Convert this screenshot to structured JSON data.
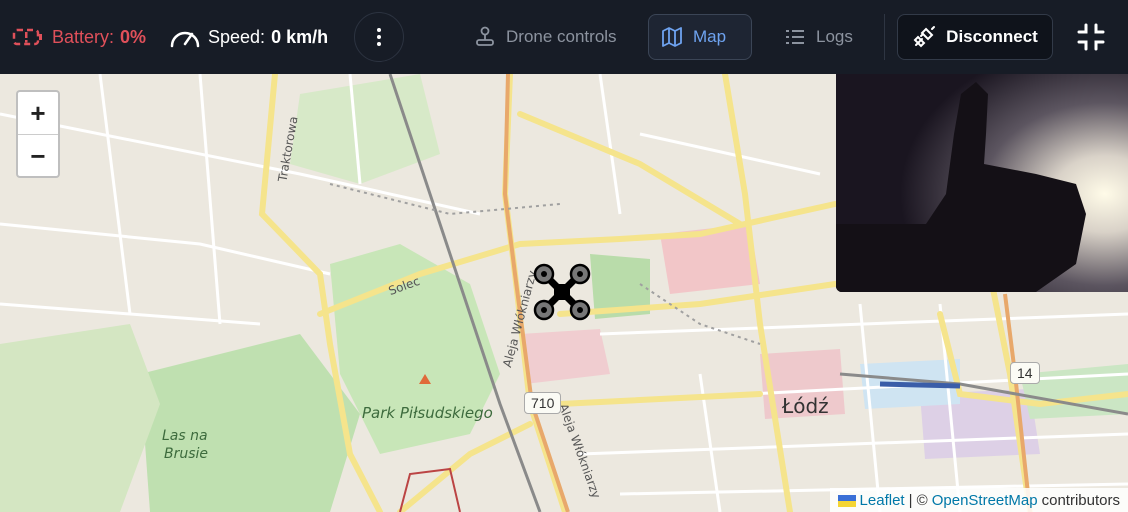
{
  "topbar": {
    "battery": {
      "label": "Battery:",
      "value": "0%",
      "color": "#e0505a",
      "icon": "battery-alert-icon"
    },
    "speed": {
      "label": "Speed:",
      "value": "0 km/h",
      "icon": "speedometer-icon"
    },
    "more_icon": "more-vertical-icon",
    "nav": [
      {
        "label": "Drone controls",
        "icon": "joystick-icon",
        "active": false
      },
      {
        "label": "Map",
        "icon": "map-icon",
        "active": true
      },
      {
        "label": "Logs",
        "icon": "list-icon",
        "active": false
      }
    ],
    "disconnect_label": "Disconnect",
    "disconnect_icon": "unplug-icon",
    "fullscreen_icon": "exit-fullscreen-icon",
    "accent": "#6ea3f0"
  },
  "map": {
    "zoom_in": "+",
    "zoom_out": "−",
    "labels": {
      "traktorowa": "Traktorowa",
      "solec": "Solec",
      "aleja": "Aleja Włókniarzy",
      "aleja2": "Aleja Włókniarzy",
      "park": "Park Piłsudskiego",
      "las": "Las na",
      "brusie": "Brusie",
      "city": "Łódź",
      "road710": "710",
      "road14": "14"
    },
    "attribution": {
      "leaflet": "Leaflet",
      "sep": "| ©",
      "osm": "OpenStreetMap",
      "suffix": "contributors"
    }
  },
  "video": {
    "icon": "camera-feed"
  },
  "drone": {
    "icon": "drone-icon"
  }
}
